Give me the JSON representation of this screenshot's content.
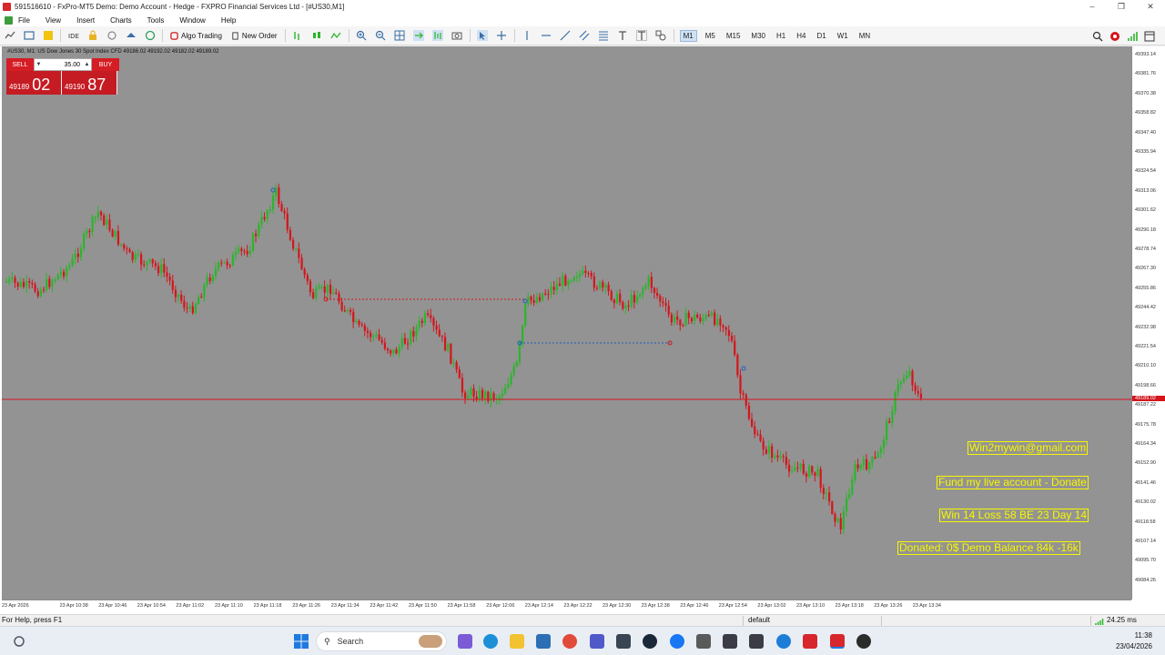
{
  "window": {
    "title": "591516610 - FxPro-MT5 Demo: Demo Account - Hedge - FXPRO Financial Services Ltd - [#US30,M1]"
  },
  "menu": [
    "File",
    "View",
    "Insert",
    "Charts",
    "Tools",
    "Window",
    "Help"
  ],
  "toolbar": {
    "algo_trading": "Algo Trading",
    "new_order": "New Order",
    "timeframes": [
      "M1",
      "M5",
      "M15",
      "M30",
      "H1",
      "H4",
      "D1",
      "W1",
      "MN"
    ],
    "active_timeframe": "M1",
    "icons": [
      "new-chart-icon",
      "profiles-icon",
      "strategy-tester-icon",
      "ide-icon",
      "lock-icon",
      "signals-icon",
      "market-icon",
      "algo-trading-icon",
      "new-order-icon",
      "bar-chart-icon",
      "candles-icon",
      "line-chart-icon",
      "zoom-in-icon",
      "zoom-out-icon",
      "grid-icon",
      "auto-scroll-icon",
      "chart-shift-icon",
      "screenshot-icon",
      "cursor-icon",
      "crosshair-icon",
      "vertical-line-icon",
      "horizontal-line-icon",
      "trendline-icon",
      "equidistant-channel-icon",
      "fibonacci-icon",
      "text-icon",
      "text-label-icon",
      "shapes-icon",
      "search-icon",
      "notifications-icon",
      "signal-strength-icon",
      "expand-icon"
    ]
  },
  "chart": {
    "info_line": "#US30, M1:  US Dow Jones 30 Spot Index CFD  49186.02 49192.02 49182.02 49189.02",
    "one_click": {
      "sell_label": "SELL",
      "buy_label": "BUY",
      "lot": "35.00",
      "bid_small": "49189",
      "bid_big": "02",
      "ask_small": "49190",
      "ask_big": "87"
    },
    "price_labels": [
      "49393.14",
      "49381.76",
      "49370.38",
      "49358.82",
      "49347.40",
      "49335.94",
      "49324.54",
      "49313.06",
      "49301.62",
      "49290.18",
      "49278.74",
      "49267.30",
      "49255.86",
      "49244.42",
      "49232.98",
      "49221.54",
      "49210.10",
      "49198.66",
      "49187.22",
      "49175.78",
      "49164.34",
      "49152.90",
      "49141.46",
      "49130.02",
      "49118.58",
      "49107.14",
      "49095.70",
      "49084.26"
    ],
    "time_labels": [
      "23 Apr 2026",
      "23 Apr 10:38",
      "23 Apr 10:46",
      "23 Apr 10:54",
      "23 Apr 11:02",
      "23 Apr 11:10",
      "23 Apr 11:18",
      "23 Apr 11:26",
      "23 Apr 11:34",
      "23 Apr 11:42",
      "23 Apr 11:50",
      "23 Apr 11:58",
      "23 Apr 12:06",
      "23 Apr 12:14",
      "23 Apr 12:22",
      "23 Apr 12:30",
      "23 Apr 12:38",
      "23 Apr 12:46",
      "23 Apr 12:54",
      "23 Apr 13:02",
      "23 Apr 13:10",
      "23 Apr 13:18",
      "23 Apr 13:26",
      "23 Apr 13:34"
    ],
    "current_price": "49189.02",
    "colors": {
      "background": "#939393",
      "bull": "#2bb52b",
      "bear": "#d4151c",
      "price_line": "#d4151c",
      "overlay_text": "#f7f700"
    },
    "overlays": [
      "Win2mywin@gmail.com",
      "Fund my live account - Donate",
      "Win 14  Loss 58  BE 23  Day 14",
      "Donated: 0$  Demo Balance 84k -16k"
    ]
  },
  "status": {
    "help": "For Help, press F1",
    "profile": "default",
    "ping": "24.25 ms"
  },
  "taskbar": {
    "search_placeholder": "Search",
    "time": "11:38",
    "date": "23/04/2026"
  }
}
